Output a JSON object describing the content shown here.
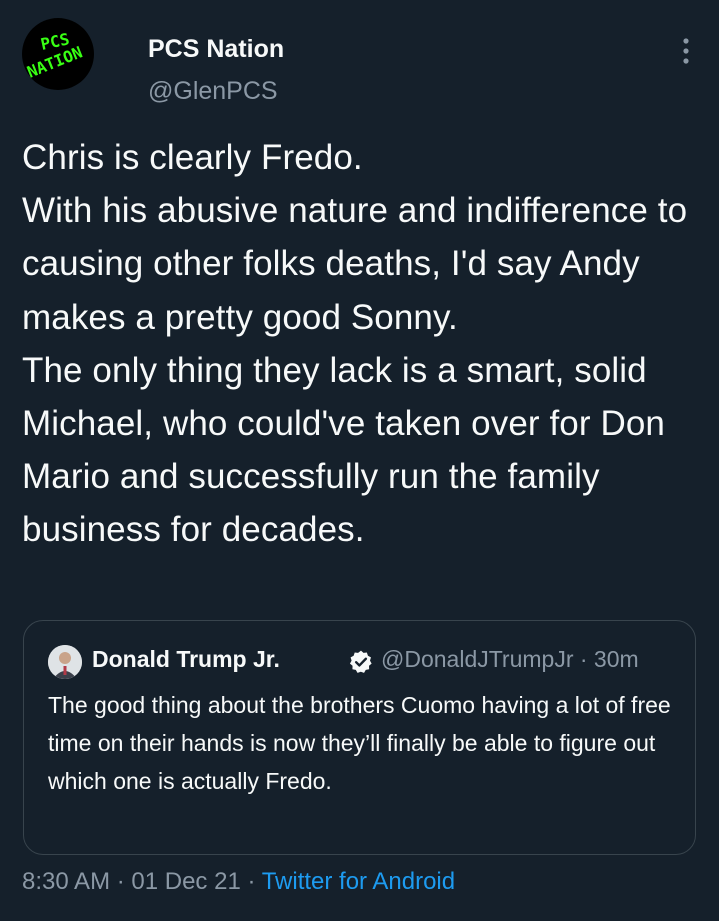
{
  "author": {
    "display_name": "PCS Nation",
    "handle": "@GlenPCS",
    "avatar_text": "PCS NATION"
  },
  "tweet": {
    "text": "Chris is clearly Fredo.\nWith his abusive nature and indifference to causing other folks deaths, I'd say Andy makes a pretty good Sonny.\nThe only thing they lack is a smart, solid Michael, who could've taken over for Don Mario and successfully run the family business for decades."
  },
  "quoted_tweet": {
    "display_name": "Donald Trump Jr.",
    "handle_time": "@DonaldJTrumpJr · 30m",
    "text": "The good thing about the brothers Cuomo having a lot of free time on their hands is now they’ll finally be able to figure out which one is actually Fredo."
  },
  "meta": {
    "timestamp": "8:30 AM · 01 Dec 21 · ",
    "source": "Twitter for Android"
  },
  "icons": {
    "more": "more-vertical-icon",
    "verified": "verified-badge-icon"
  },
  "colors": {
    "background": "#15202b",
    "text": "#f7f9f9",
    "secondary": "#8b98a5",
    "link": "#1d9bf0",
    "avatar_logo": "#39ff14",
    "border": "#38444d"
  }
}
